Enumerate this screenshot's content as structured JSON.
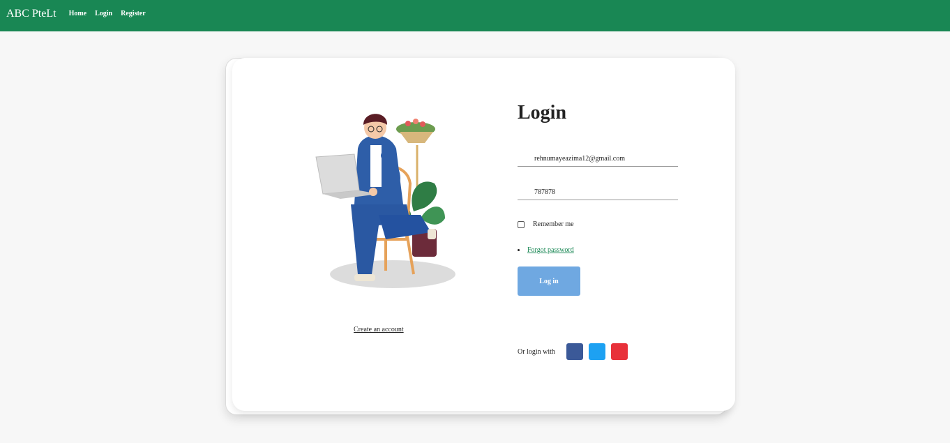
{
  "navbar": {
    "brand": "ABC PteLt",
    "links": [
      "Home",
      "Login",
      "Register"
    ]
  },
  "login": {
    "title": "Login",
    "email_value": "rehnumayeazima12@gmail.com",
    "password_value": "787878",
    "remember_label": "Remember me",
    "forgot_label": "Forgot password",
    "login_button": "Log in",
    "social_label": "Or login with",
    "social_buttons": [
      {
        "icon": "facebook-icon",
        "color": "#3b5998"
      },
      {
        "icon": "twitter-icon",
        "color": "#1da1f2"
      },
      {
        "icon": "google-icon",
        "color": "#e8313a"
      }
    ]
  },
  "illustration": {
    "create_account": "Create an account"
  },
  "colors": {
    "navbar": "#198754",
    "login_button": "#6fa8e1",
    "link": "#198754"
  }
}
